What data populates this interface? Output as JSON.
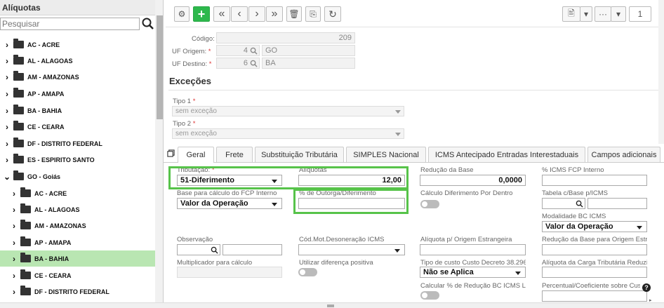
{
  "left_panel": {
    "title": "Alíquotas",
    "search_placeholder": "Pesquisar",
    "tree": [
      {
        "label": "AC - ACRE",
        "expanded": false,
        "level": 0
      },
      {
        "label": "AL - ALAGOAS",
        "expanded": false,
        "level": 0
      },
      {
        "label": "AM - AMAZONAS",
        "expanded": false,
        "level": 0
      },
      {
        "label": "AP - AMAPA",
        "expanded": false,
        "level": 0
      },
      {
        "label": "BA - BAHIA",
        "expanded": false,
        "level": 0
      },
      {
        "label": "CE - CEARA",
        "expanded": false,
        "level": 0
      },
      {
        "label": "DF - DISTRITO FEDERAL",
        "expanded": false,
        "level": 0
      },
      {
        "label": "ES - ESPIRITO SANTO",
        "expanded": false,
        "level": 0
      },
      {
        "label": "GO - Goiás",
        "expanded": true,
        "level": 0
      },
      {
        "label": "AC - ACRE",
        "expanded": false,
        "level": 1
      },
      {
        "label": "AL - ALAGOAS",
        "expanded": false,
        "level": 1
      },
      {
        "label": "AM - AMAZONAS",
        "expanded": false,
        "level": 1
      },
      {
        "label": "AP - AMAPA",
        "expanded": false,
        "level": 1
      },
      {
        "label": "BA - BAHIA",
        "expanded": false,
        "level": 1,
        "selected": true
      },
      {
        "label": "CE - CEARA",
        "expanded": false,
        "level": 1
      },
      {
        "label": "DF - DISTRITO FEDERAL",
        "expanded": false,
        "level": 1
      }
    ]
  },
  "toolbar": {
    "gear": "⚙",
    "add": "+",
    "first": "«",
    "prev": "‹",
    "next": "›",
    "last": "»",
    "delete": "🗑",
    "copy": "⎘",
    "refresh": "↻",
    "export": "🖹",
    "caret": "▾",
    "more": "···",
    "record_count": "1"
  },
  "header_form": {
    "codigo_label": "Código:",
    "codigo_value": "209",
    "uf_origem_label": "UF Origem:",
    "uf_origem_code": "4",
    "uf_origem_value": "GO",
    "uf_destino_label": "UF Destino:",
    "uf_destino_code": "6",
    "uf_destino_value": "BA",
    "required_mark": "*"
  },
  "excecoes": {
    "title": "Exceções",
    "tipo1_label": "Tipo 1",
    "tipo1_value": "sem exceção",
    "tipo2_label": "Tipo 2",
    "tipo2_value": "sem exceção"
  },
  "tabs": [
    "Geral",
    "Frete",
    "Substituição Tributária",
    "SIMPLES Nacional",
    "ICMS Antecipado Entradas Interestaduais",
    "Campos adicionais"
  ],
  "geral": {
    "tributacao_label": "Tributação:",
    "tributacao_value": "51-Diferimento",
    "aliquotas_label": "Alíquotas",
    "aliquotas_value": "12,00",
    "reducao_base_label": "Redução da Base",
    "reducao_base_value": "0,0000",
    "icms_fcp_label": "% ICMS FCP Interno",
    "base_fcp_label": "Base para cálculo do FCP Interno",
    "base_fcp_value": "Valor da Operação",
    "outorga_label": "% de Outorga/Diferimento",
    "calculo_dif_label": "Cálculo Diferimento Por Dentro",
    "tabela_base_label": "Tabela c/Base p/ICMS",
    "modalidade_label": "Modalidade BC ICMS",
    "modalidade_value": "Valor da Operação",
    "observacao_label": "Observação",
    "cod_mot_label": "Cód.Mot.Desoneração ICMS",
    "aliq_origem_label": "Alíquota p/ Origem Estrangeira",
    "reducao_origem_label": "Redução da Base para Origem Estran",
    "multiplicador_label": "Multiplicador para cálculo",
    "utilizar_dif_label": "Utilizar diferença positiva",
    "tipo_custo_label": "Tipo de custo Custo Decreto 38.296/F",
    "tipo_custo_value": "Não se Aplica",
    "aliq_carga_label": "Alíquota da Carga Tributária Reduzida",
    "calcular_reducao_label": "Calcular % de Redução BC ICMS Lei",
    "percentual_label": "Percentual/Coeficiente sobre Custo A",
    "help": "?"
  },
  "colors": {
    "accent_green": "#2db84c",
    "highlight_green": "#57c34a",
    "selected_row": "#b9e6b2"
  }
}
